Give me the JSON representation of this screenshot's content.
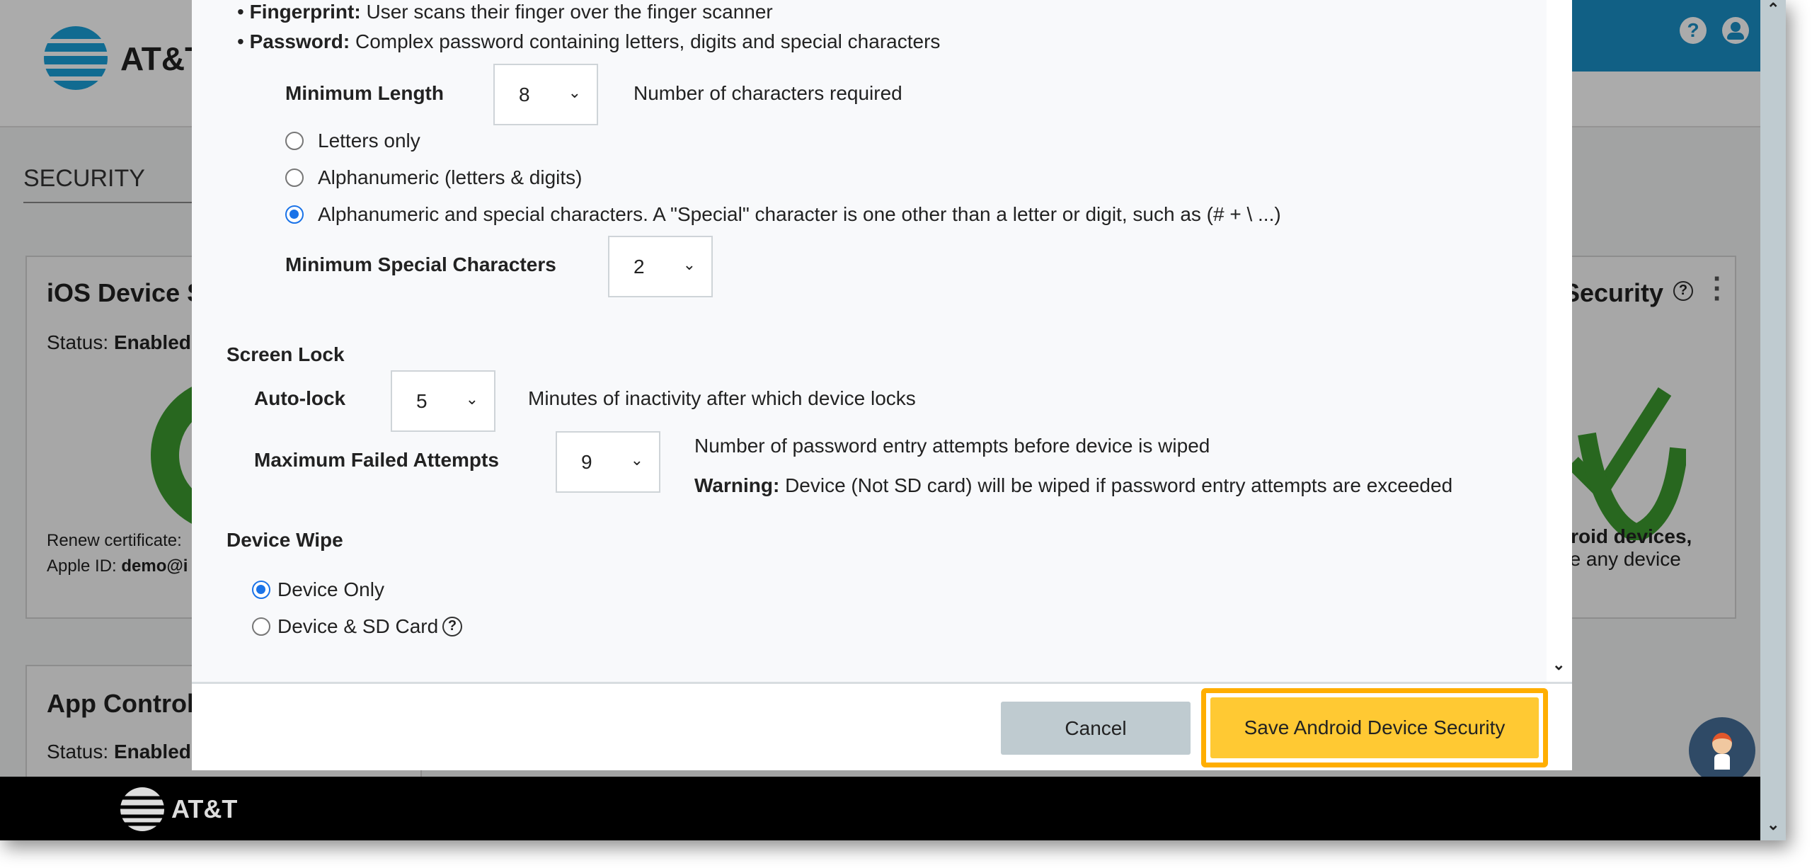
{
  "background": {
    "brand": "AT&T",
    "section_title": "SECURITY",
    "ios_card": {
      "title": "iOS Device S",
      "status_label": "Status:",
      "status_value": "Enabled",
      "renew_label": "Renew certificate: ",
      "apple_id_label": "Apple ID: ",
      "apple_id_value": "demo@i"
    },
    "android_card": {
      "title": "Security",
      "line1": "droid devices,",
      "line2": "pe any device"
    },
    "app_card": {
      "title": "App Control",
      "status_label": "Status:",
      "status_value": "Enabled"
    },
    "footer_brand": "AT&T",
    "icons": [
      "help-icon",
      "user-icon",
      "chat-avatar-icon"
    ]
  },
  "modal": {
    "fingerprint": {
      "label": "Fingerprint:",
      "text": "User scans their finger over the finger scanner"
    },
    "password": {
      "label": "Password:",
      "text": "Complex password containing letters, digits and special characters"
    },
    "min_length": {
      "label": "Minimum Length",
      "value": "8",
      "note": "Number of characters required"
    },
    "complexity": [
      {
        "label": "Letters only",
        "selected": false
      },
      {
        "label": "Alphanumeric (letters & digits)",
        "selected": false
      },
      {
        "label": "Alphanumeric and special characters. A \"Special\" character is one other than a letter or digit, such as  (# + \\ ...)",
        "selected": true
      }
    ],
    "min_special": {
      "label": "Minimum Special Characters",
      "value": "2"
    },
    "screen_lock": {
      "title": "Screen Lock",
      "auto_lock": {
        "label": "Auto-lock",
        "value": "5",
        "note": "Minutes of inactivity after which device locks"
      },
      "max_failed": {
        "label": "Maximum Failed Attempts",
        "value": "9",
        "note": "Number of password entry attempts before device is wiped",
        "warning_label": "Warning:",
        "warning_text": "Device (Not SD card) will be wiped if password entry attempts are exceeded"
      }
    },
    "device_wipe": {
      "title": "Device Wipe",
      "options": [
        {
          "label": "Device Only",
          "selected": true
        },
        {
          "label": "Device & SD Card",
          "selected": false
        }
      ]
    },
    "cancel_label": "Cancel",
    "save_label": "Save Android Device Security"
  },
  "colors": {
    "brand_blue": "#1a8fc6",
    "save_button": "#ffc933",
    "highlight": "#ffae00",
    "cancel_button": "#bfcbd0",
    "radio_selected": "#1a73e8",
    "success_green": "#3c9a2f"
  }
}
